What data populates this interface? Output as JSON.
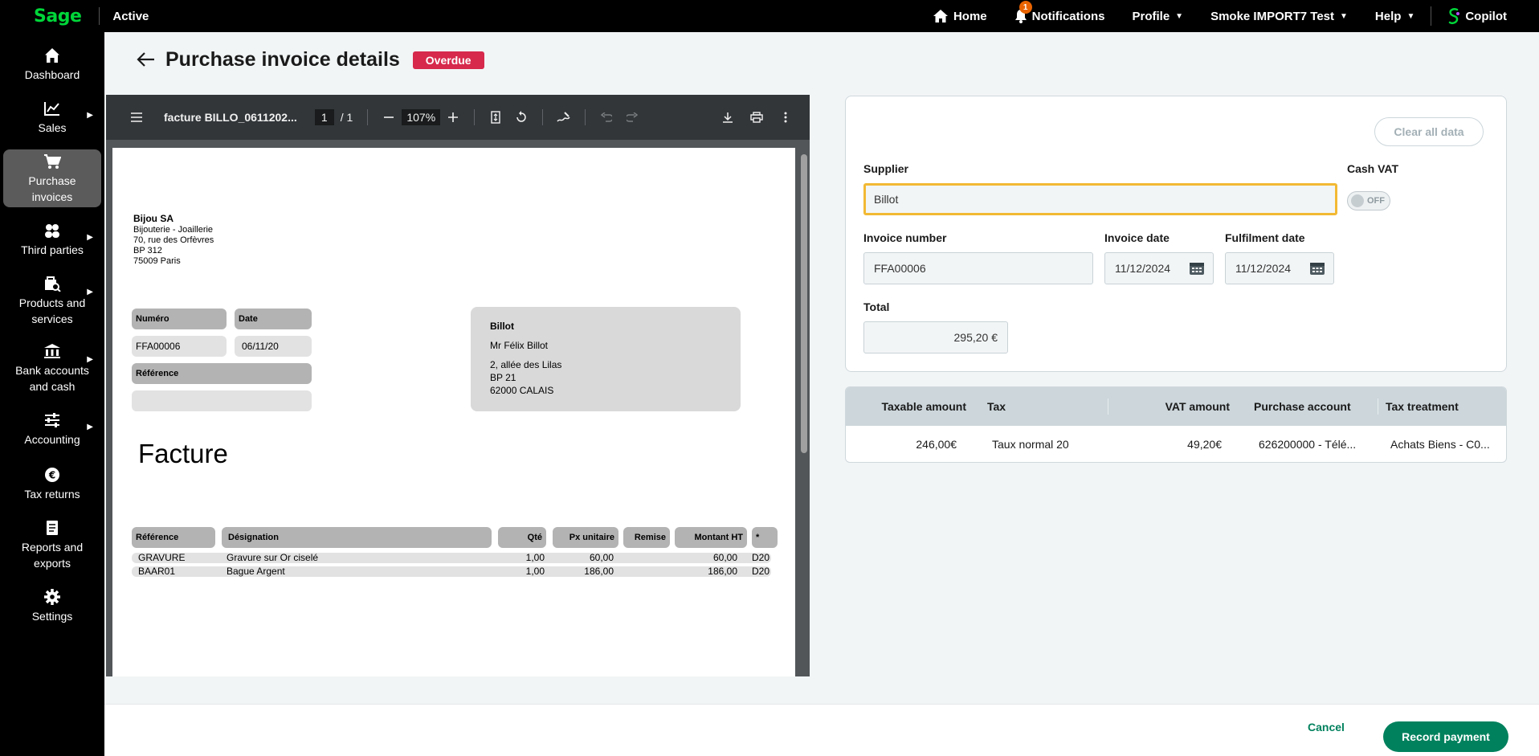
{
  "topbar": {
    "logo": "Sage",
    "status": "Active",
    "home": "Home",
    "notifications": "Notifications",
    "notifications_count": "1",
    "profile": "Profile",
    "company": "Smoke IMPORT7 Test",
    "help": "Help",
    "copilot": "Copilot"
  },
  "sidebar": {
    "items": [
      {
        "label": "Dashboard",
        "icon": "home-icon"
      },
      {
        "label": "Sales",
        "icon": "chart-line-icon"
      },
      {
        "label": "Purchase invoices",
        "icon": "cart-icon"
      },
      {
        "label": "Third parties",
        "icon": "people-icon"
      },
      {
        "label": "Products and services",
        "icon": "products-icon"
      },
      {
        "label": "Bank accounts and cash",
        "icon": "bank-icon"
      },
      {
        "label": "Accounting",
        "icon": "sliders-icon"
      },
      {
        "label": "Tax returns",
        "icon": "euro-icon"
      },
      {
        "label": "Reports and exports",
        "icon": "report-icon"
      },
      {
        "label": "Settings",
        "icon": "gear-icon"
      }
    ]
  },
  "page": {
    "title": "Purchase invoice details",
    "status_badge": "Overdue"
  },
  "pdf": {
    "filename": "facture BILLO_0611202...",
    "page_current": "1",
    "page_total": "/  1",
    "zoom": "107%",
    "doc": {
      "company_name": "Bijou SA",
      "company_lines": [
        "Bijouterie - Joaillerie",
        "70, rue des Orfèvres",
        "BP 312",
        "75009 Paris"
      ],
      "numero_label": "Numéro",
      "date_label": "Date",
      "numero_value": "FFA00006",
      "date_value": "06/11/20",
      "reference_label": "Référence",
      "recipient_name": "Billot",
      "recipient_contact": "Mr Félix Billot",
      "recipient_lines": [
        "2, allée des Lilas",
        "BP 21",
        "62000 CALAIS"
      ],
      "heading": "Facture",
      "table_headers": [
        "Référence",
        "Désignation",
        "Qté",
        "Px unitaire",
        "Remise",
        "Montant HT",
        "*"
      ],
      "rows": [
        {
          "ref": "GRAVURE",
          "designation": "Gravure sur Or ciselé",
          "qty": "1,00",
          "unit": "60,00",
          "amount": "60,00",
          "tax": "D20"
        },
        {
          "ref": "BAAR01",
          "designation": "Bague Argent",
          "qty": "1,00",
          "unit": "186,00",
          "amount": "186,00",
          "tax": "D20"
        }
      ]
    }
  },
  "form": {
    "clear_label": "Clear all data",
    "supplier_label": "Supplier",
    "supplier_value": "Billot",
    "cash_vat_label": "Cash VAT",
    "cash_vat_state": "OFF",
    "invoice_number_label": "Invoice number",
    "invoice_number_value": "FFA00006",
    "invoice_date_label": "Invoice date",
    "invoice_date_value": "11/12/2024",
    "fulfilment_date_label": "Fulfilment date",
    "fulfilment_date_value": "11/12/2024",
    "total_label": "Total",
    "total_value": "295,20 €"
  },
  "vat_table": {
    "headers": [
      "Taxable amount",
      "Tax",
      "VAT amount",
      "Purchase account",
      "Tax treatment"
    ],
    "rows": [
      {
        "taxable": "246,00€",
        "tax": "Taux normal 20",
        "vat": "49,20€",
        "account": "626200000 - Télé...",
        "treatment": "Achats Biens - C0..."
      }
    ]
  },
  "footer": {
    "cancel": "Cancel",
    "record": "Record payment"
  },
  "colors": {
    "brand": "#00d639",
    "primary": "#00815d",
    "overdue": "#d6294c",
    "focus": "#f2b933"
  }
}
